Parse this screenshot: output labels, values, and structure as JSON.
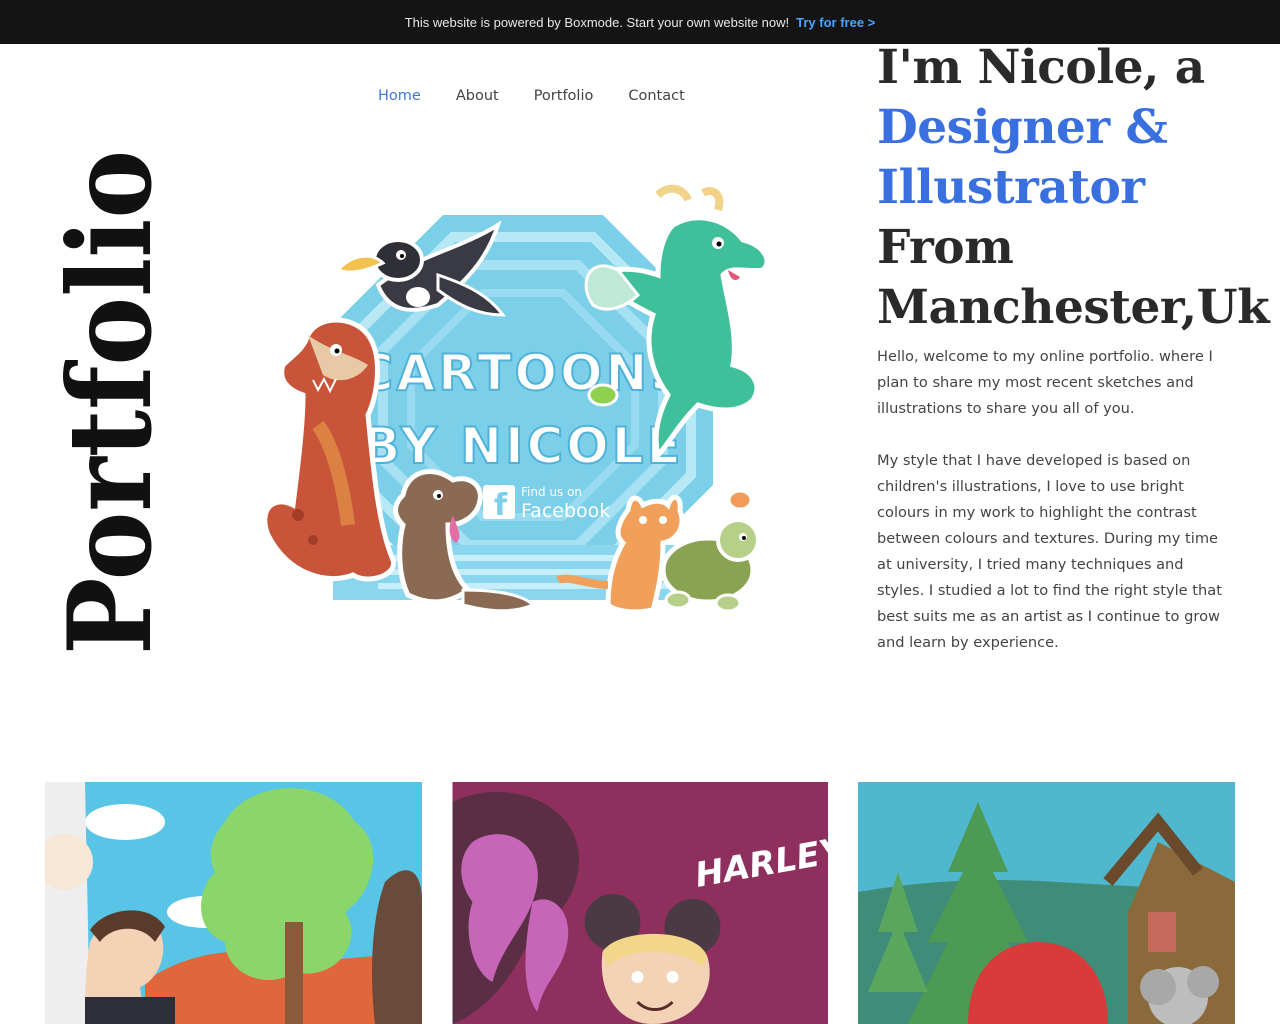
{
  "promo": {
    "text": "This website is powered by Boxmode. Start your own website now!",
    "cta": "Try for free >"
  },
  "nav": {
    "items": [
      "Home",
      "About",
      "Portfolio",
      "Contact"
    ],
    "active": "Home",
    "active_color": "#3a78d8"
  },
  "vertical_title": "Portfolio",
  "hero": {
    "logo_line1": "CARTOONS",
    "logo_line2": "BY NICOLE",
    "fb_line1": "Find us on",
    "fb_line2": "Facebook"
  },
  "headline": {
    "line1": "I'm Nicole, a",
    "line2": "Designer &",
    "line3": "Illustrator",
    "line4": "From",
    "line5": "Manchester,Uk",
    "accent_color": "#3a6fe0"
  },
  "bio": {
    "p1": "Hello, welcome to my online portfolio. where I plan to share my most recent sketches and illustrations to share you all of you.",
    "p2": "My style that I have developed is based on children's illustrations, I love to use bright colours in my work to highlight the contrast between colours and textures. During my time at university, I tried many techniques and styles. I studied a lot to find the right style that best suits me as an artist as I continue to grow and learn by experience."
  },
  "gallery": {
    "card2_text": "HARLEY Q"
  }
}
